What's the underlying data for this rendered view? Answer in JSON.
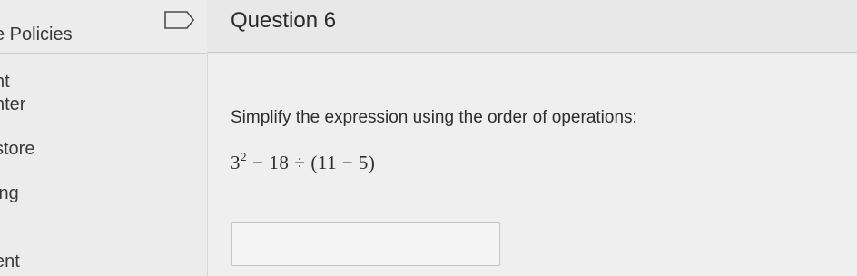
{
  "sidebar": {
    "items": [
      {
        "label": "e Policies"
      },
      {
        "label": "nt"
      },
      {
        "label": "nter"
      },
      {
        "label": "store"
      },
      {
        "label": "ing"
      },
      {
        "label": "ent"
      }
    ]
  },
  "question": {
    "title": "Question 6",
    "prompt": "Simplify the expression using the order of operations:",
    "expression": {
      "base": "3",
      "exponent": "2",
      "op1": "−",
      "n1": "18",
      "op2": "÷",
      "paren": "(11 − 5)"
    },
    "answer_value": ""
  },
  "icons": {
    "flag": "bookmark-flag-icon"
  }
}
